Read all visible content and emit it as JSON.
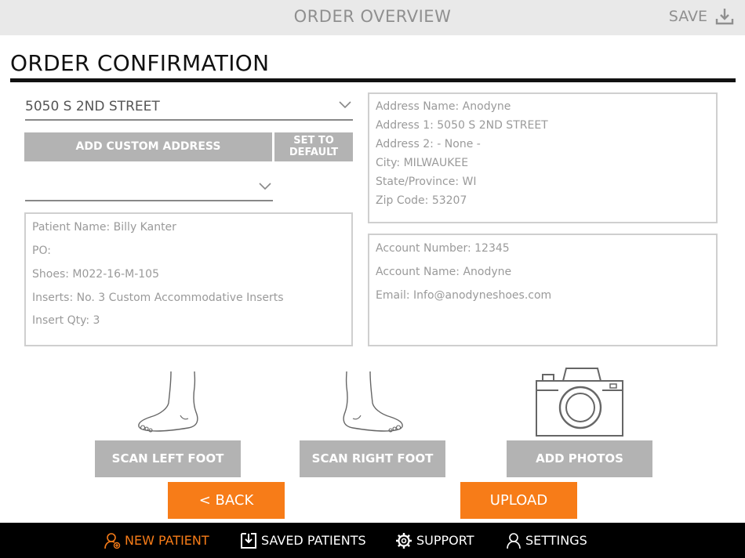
{
  "header": {
    "title": "ORDER OVERVIEW",
    "save_label": "SAVE",
    "save_icon": "download-icon"
  },
  "page": {
    "heading": "ORDER CONFIRMATION"
  },
  "address_select": {
    "value": "5050 S 2ND STREET",
    "icon": "chevron-down-icon"
  },
  "buttons": {
    "add_custom_address": "ADD CUSTOM ADDRESS",
    "set_to_default_line1": "SET TO",
    "set_to_default_line2": "DEFAULT",
    "scan_left_foot": "SCAN LEFT FOOT",
    "scan_right_foot": "SCAN RIGHT FOOT",
    "add_photos": "ADD PHOTOS",
    "back": "< BACK",
    "upload": "UPLOAD"
  },
  "secondary_select": {
    "value": ""
  },
  "patient_info": {
    "patient_name": "Patient Name: Billy Kanter",
    "po": "PO:",
    "shoes": "Shoes: M022-16-M-105",
    "inserts": "Inserts: No. 3 Custom Accommodative Inserts",
    "insert_qty": "Insert Qty: 3"
  },
  "address_info": {
    "name": "Address Name: Anodyne",
    "address1": "Address 1: 5050 S 2ND STREET",
    "address2": "Address 2: - None -",
    "city": "City: MILWAUKEE",
    "state": "State/Province: WI",
    "zip": "Zip Code: 53207"
  },
  "account_info": {
    "number": "Account Number: 12345",
    "name": "Account Name: Anodyne",
    "email": "Email: Info@anodyneshoes.com"
  },
  "bottom_nav": [
    {
      "label": "NEW PATIENT",
      "icon": "add-user-icon",
      "active": true
    },
    {
      "label": "SAVED PATIENTS",
      "icon": "save-tray-icon",
      "active": false
    },
    {
      "label": "SUPPORT",
      "icon": "gear-icon",
      "active": false
    },
    {
      "label": "SETTINGS",
      "icon": "user-icon",
      "active": false
    }
  ],
  "colors": {
    "accent": "#f77c18",
    "button_gray": "#b3b3b3",
    "nav_bg": "#000000"
  }
}
